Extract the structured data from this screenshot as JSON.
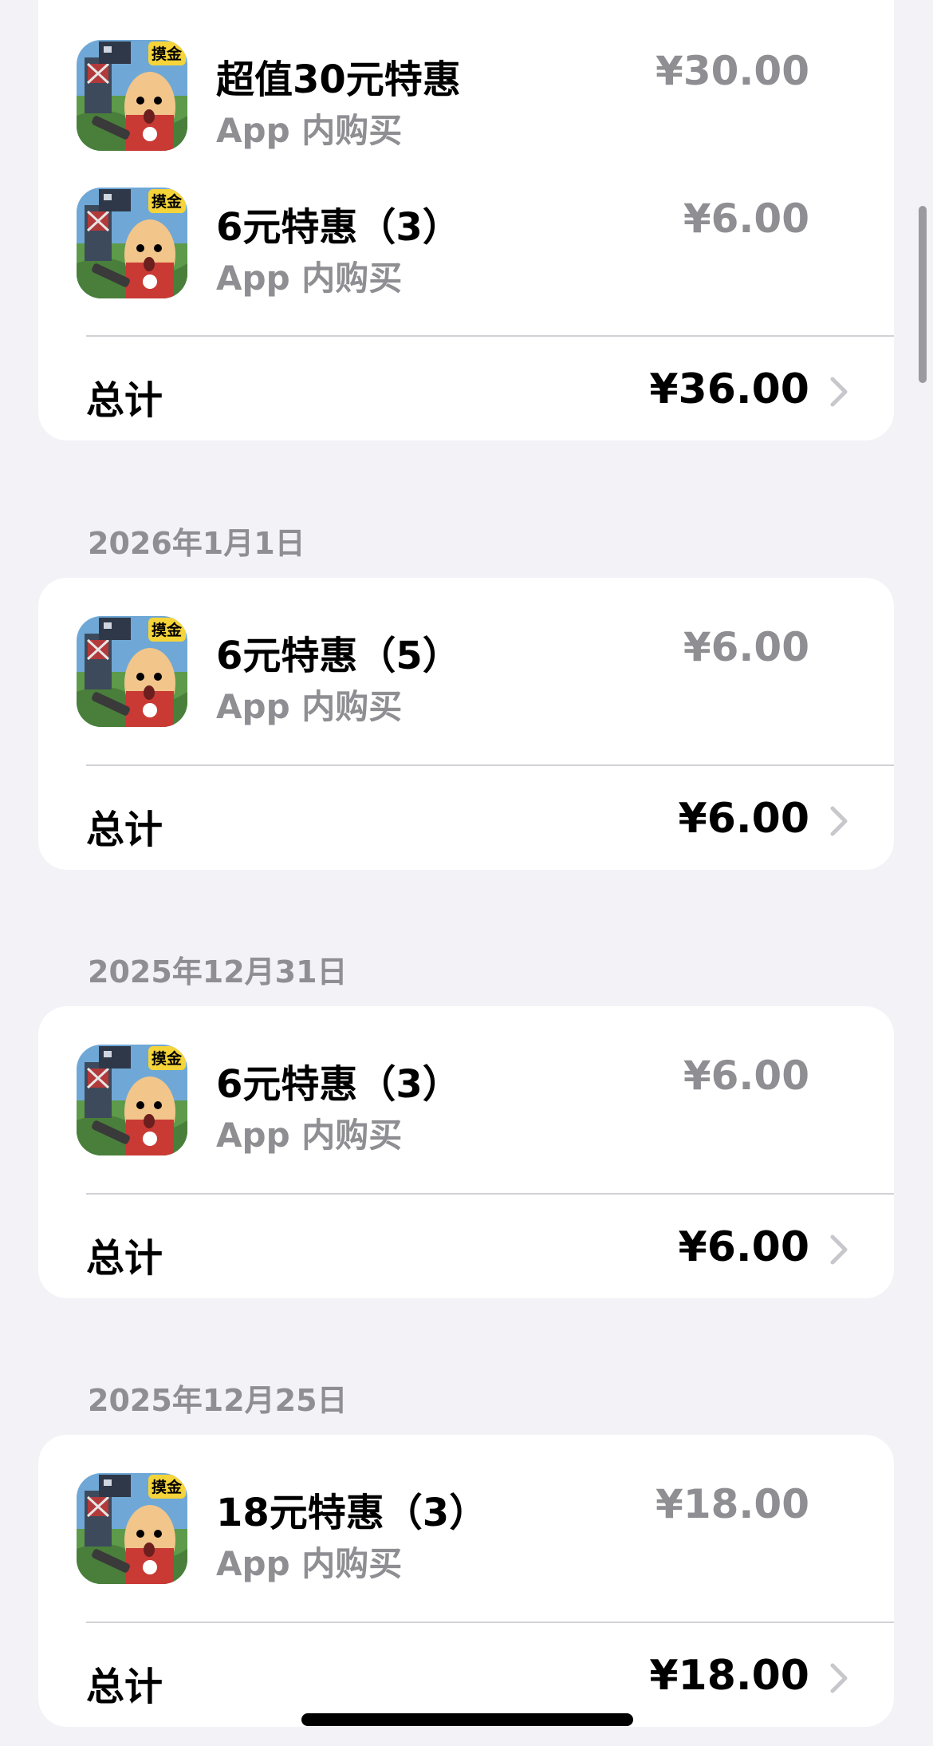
{
  "icon_name": "game-app-icon",
  "icon_badge": "摸金",
  "colors": {
    "background": "#f2f2f7",
    "card": "#ffffff",
    "secondary_text": "#8e8e93",
    "divider": "#d1d1d6"
  },
  "groups": [
    {
      "date": "",
      "items": [
        {
          "title": "超值30元特惠",
          "subtitle": "App 内购买",
          "price": "¥30.00"
        },
        {
          "title": "6元特惠（3）",
          "subtitle": "App 内购买",
          "price": "¥6.00"
        }
      ],
      "total_label": "总计",
      "total": "¥36.00"
    },
    {
      "date": "2026年1月1日",
      "items": [
        {
          "title": "6元特惠（5）",
          "subtitle": "App 内购买",
          "price": "¥6.00"
        }
      ],
      "total_label": "总计",
      "total": "¥6.00"
    },
    {
      "date": "2025年12月31日",
      "items": [
        {
          "title": "6元特惠（3）",
          "subtitle": "App 内购买",
          "price": "¥6.00"
        }
      ],
      "total_label": "总计",
      "total": "¥6.00"
    },
    {
      "date": "2025年12月25日",
      "items": [
        {
          "title": "18元特惠（3）",
          "subtitle": "App 内购买",
          "price": "¥18.00"
        }
      ],
      "total_label": "总计",
      "total": "¥18.00"
    }
  ]
}
